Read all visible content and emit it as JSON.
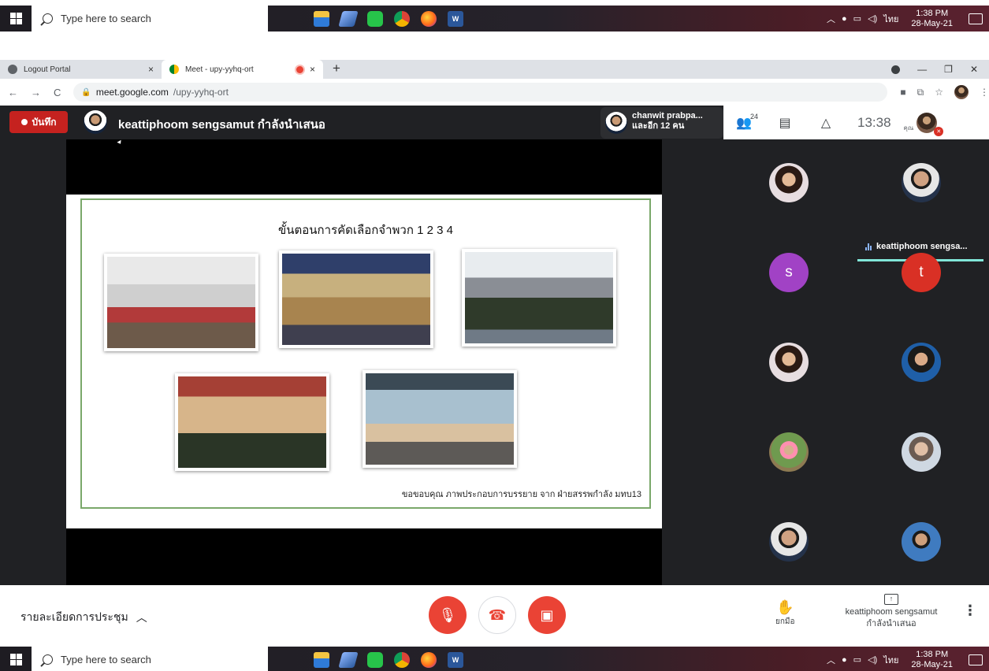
{
  "taskbar": {
    "search_placeholder": "Type here to search",
    "time": "1:38 PM",
    "date": "28-May-21",
    "lang": "ไทย"
  },
  "browser": {
    "tabs": [
      {
        "title": "Logout Portal",
        "close": "×"
      },
      {
        "title": "Meet - upy-yyhq-ort",
        "close": "×"
      }
    ],
    "new_tab": "+",
    "url_host": "meet.google.com",
    "url_path": "/upy-yyhq-ort"
  },
  "meet": {
    "record_label": "บันทึก",
    "presenter_text": "keattiphoom sengsamut กำลังนำเสนอ",
    "peek_name": "chanwit prabpa...",
    "peek_more": "และอีก 12 คน",
    "people_count": "24",
    "clock": "13:38",
    "you_label": "คุณ",
    "speaking_name": "keattiphoom sengsa...",
    "tiles": [
      {
        "letter": "",
        "color": ""
      },
      {
        "letter": "",
        "color": ""
      },
      {
        "letter": "s",
        "color": "#a142c5"
      },
      {
        "letter": "t",
        "color": "#d93025"
      }
    ],
    "details_label": "รายละเอียดการประชุม",
    "raise_hand": "ยกมือ",
    "presenting_name": "keattiphoom sengsamut",
    "presenting_status": "กำลังนำเสนอ"
  },
  "slide": {
    "title": "ขั้นตอนการคัดเลือกจำพวก 1 2 3 4",
    "credit": "ขอขอบคุณ ภาพประกอบการบรรยาย จาก ฝ่ายสรรพกำลัง มทบ13"
  },
  "colors": {
    "record": "#c5221f",
    "end_call": "#ea4335",
    "slide_border": "#7aa86a",
    "speaking_line": "#81e6d9"
  }
}
